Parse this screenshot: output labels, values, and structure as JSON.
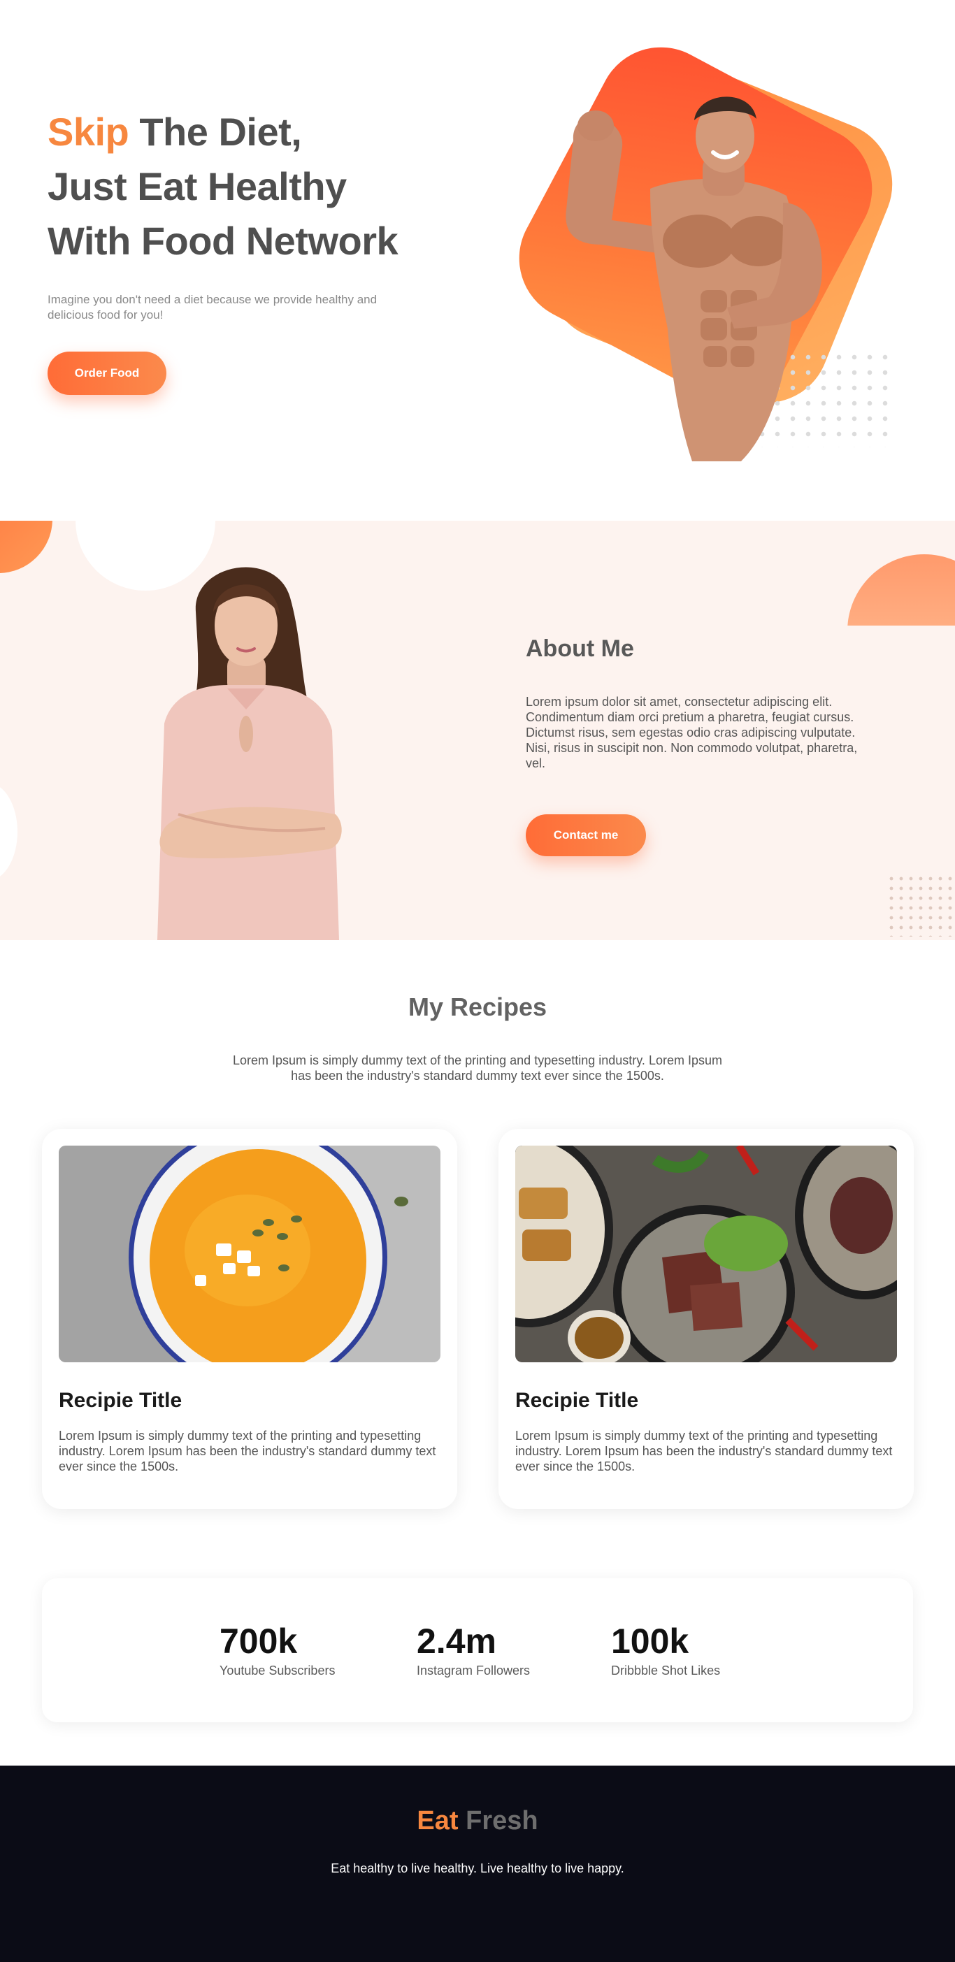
{
  "hero": {
    "title_accent": "Skip",
    "title_line1_rest": " The Diet,",
    "title_line2": "Just Eat Healthy",
    "title_line3": "With Food Network",
    "subtitle": "Imagine you don't need a diet because we provide healthy and delicious food for you!",
    "cta_label": "Order Food"
  },
  "about": {
    "title": "About Me",
    "text": "Lorem ipsum dolor sit amet, consectetur adipiscing elit. Condimentum diam orci pretium a pharetra, feugiat cursus. Dictumst risus, sem egestas odio cras adipiscing vulputate. Nisi, risus in suscipit non. Non commodo volutpat, pharetra, vel.",
    "cta_label": "Contact me"
  },
  "recipes": {
    "title": "My Recipes",
    "description": "Lorem Ipsum is simply dummy text of the printing and typesetting industry. Lorem Ipsum has been the industry's standard dummy text ever since the 1500s.",
    "cards": [
      {
        "title": "Recipie Title",
        "text": "Lorem Ipsum is simply dummy text of the printing and typesetting industry. Lorem Ipsum has been the industry's standard dummy text ever since the 1500s."
      },
      {
        "title": "Recipie Title",
        "text": "Lorem Ipsum is simply dummy text of the printing and typesetting industry. Lorem Ipsum has been the industry's standard dummy text ever since the 1500s."
      }
    ]
  },
  "stats": [
    {
      "value": "700k",
      "label": "Youtube Subscribers"
    },
    {
      "value": "2.4m",
      "label": "Instagram Followers"
    },
    {
      "value": "100k",
      "label": "Dribbble Shot Likes"
    }
  ],
  "footer": {
    "brand_accent": "Eat",
    "brand_rest": "Fresh",
    "tagline": "Eat healthy to live healthy. Live healthy to live happy."
  },
  "colors": {
    "accent": "#f7873f",
    "button_gradient_start": "#ff6c37",
    "button_gradient_end": "#fb8a4c",
    "about_bg": "#fdf3ef",
    "footer_bg": "#0b0c16"
  }
}
